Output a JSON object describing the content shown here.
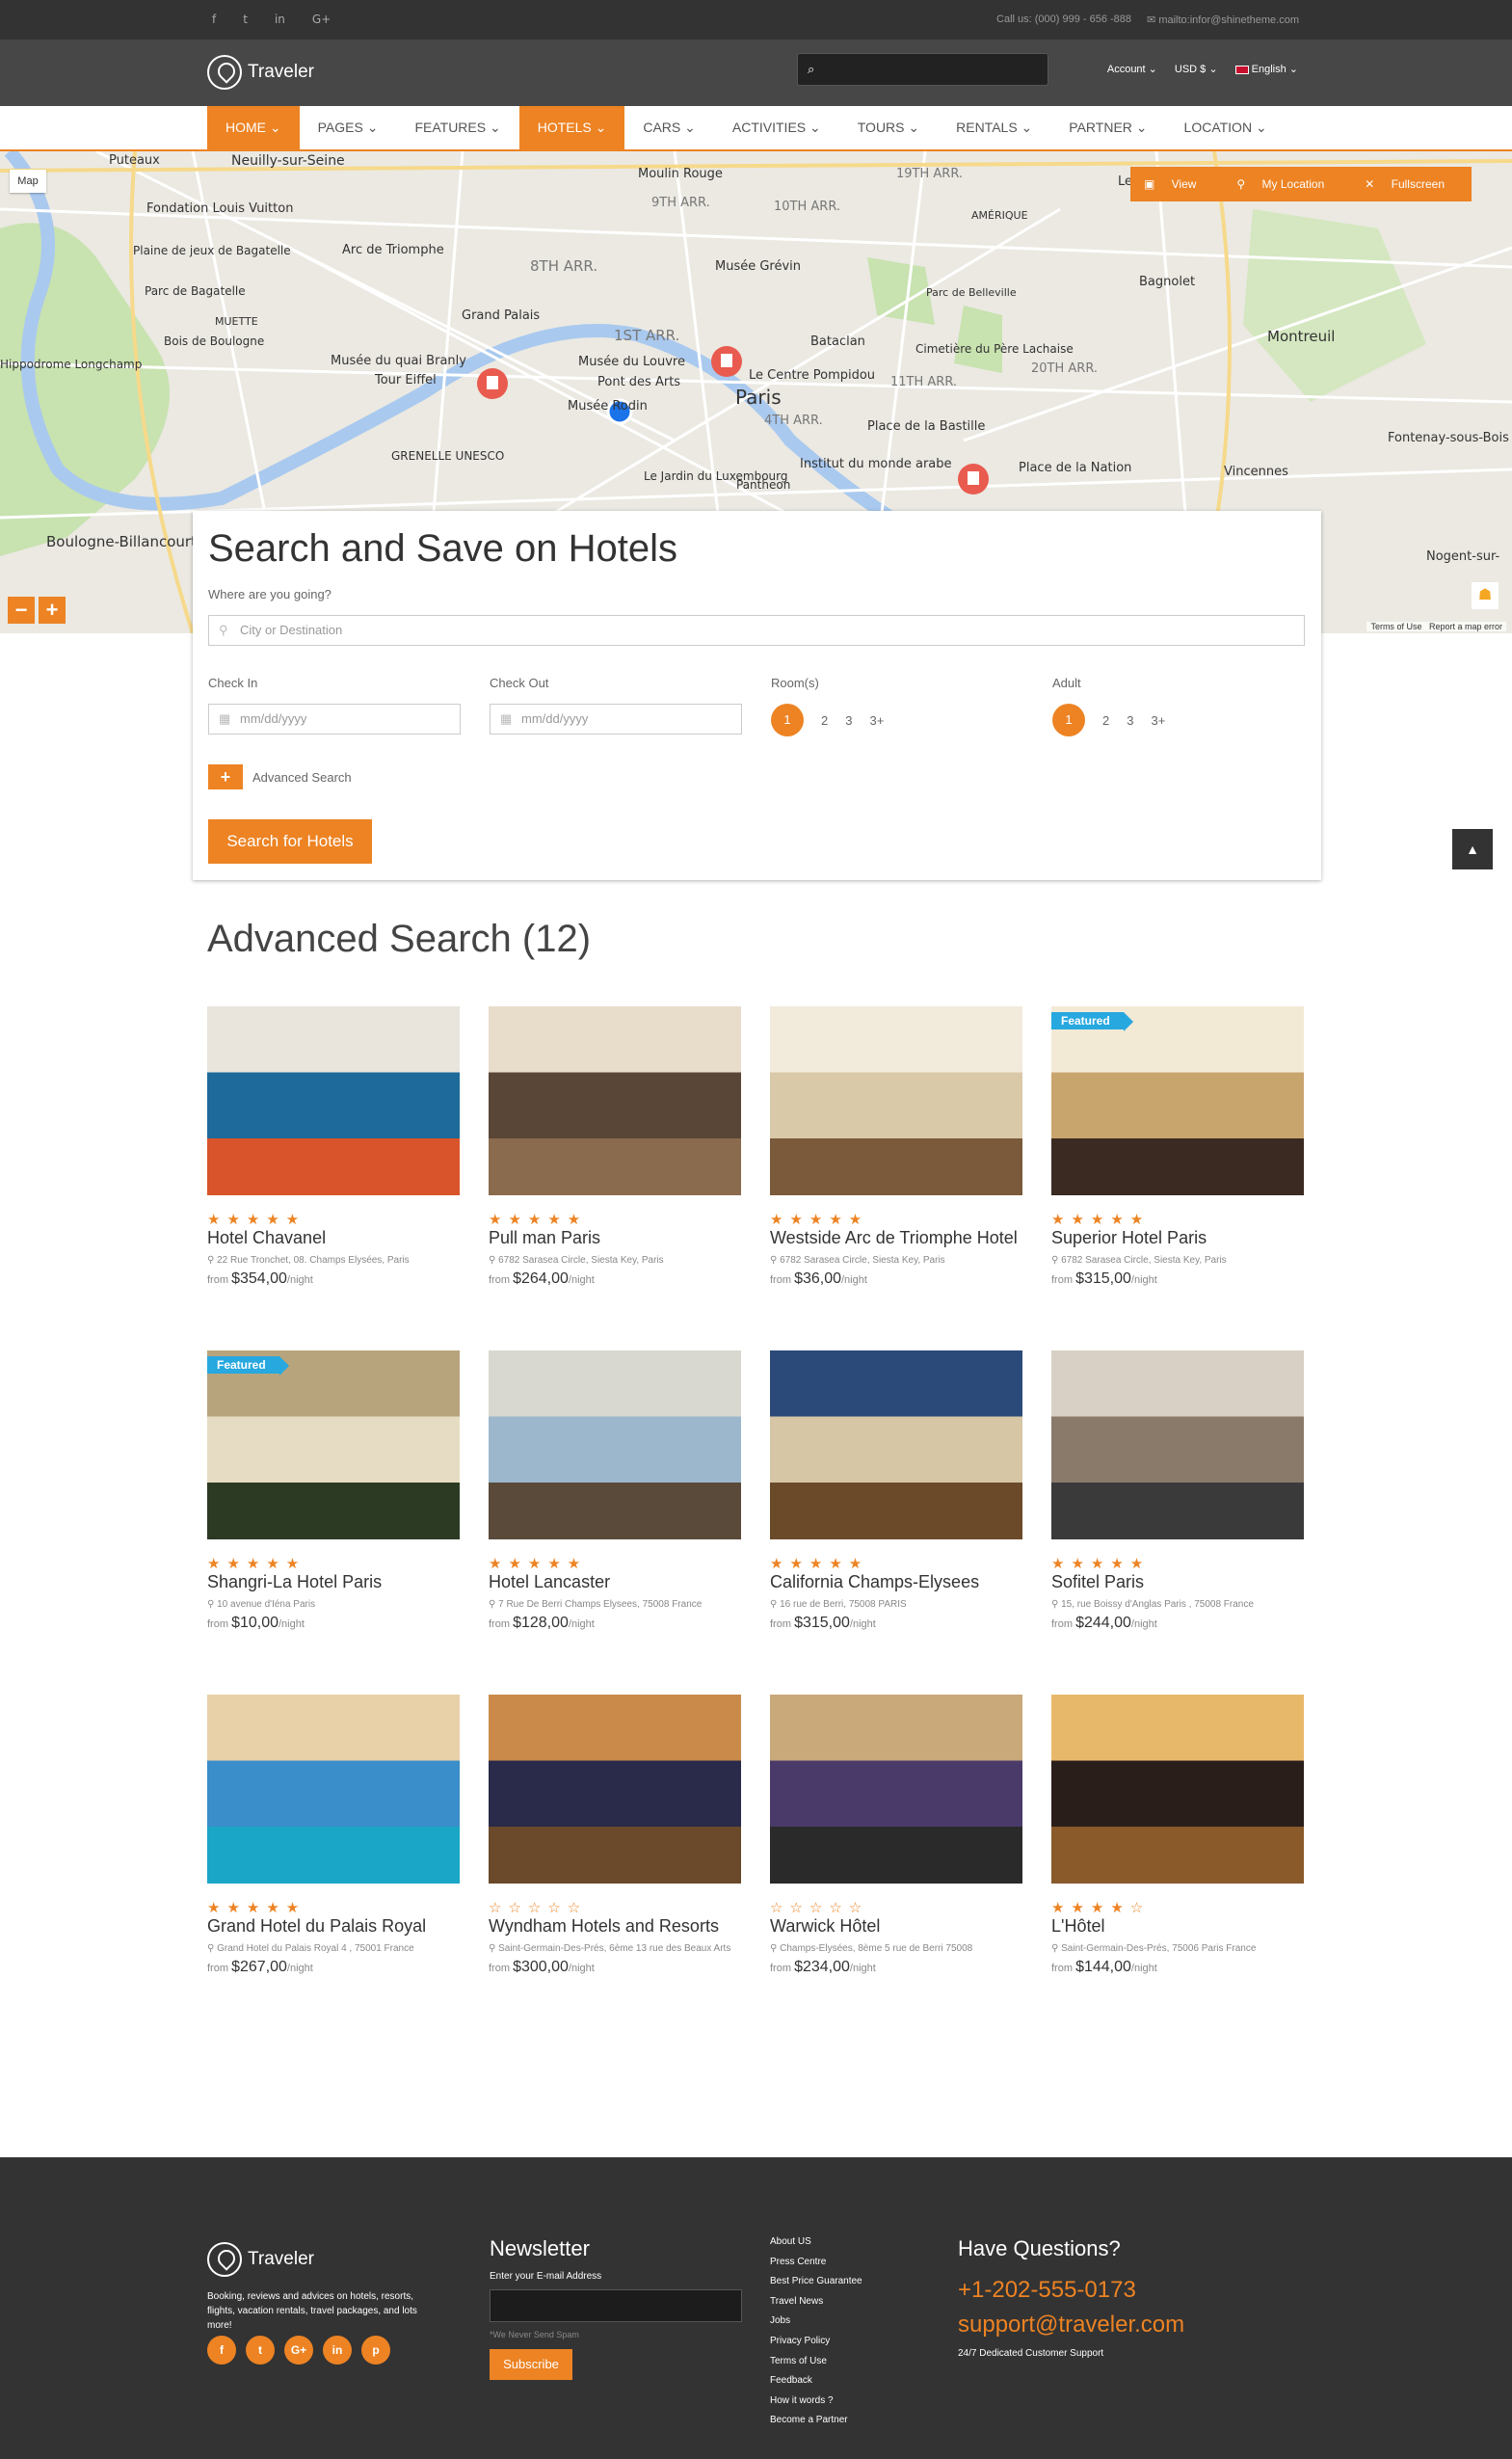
{
  "topbar": {
    "social": [
      "f",
      "t",
      "in",
      "G+"
    ],
    "phone": "Call us: (000) 999 - 656 -888",
    "email": "mailto:infor@shinetheme.com"
  },
  "header": {
    "brand": "Traveler",
    "account": "Account",
    "currency": "USD $",
    "language": "English"
  },
  "nav": [
    "HOME",
    "PAGES",
    "FEATURES",
    "HOTELS",
    "CARS",
    "ACTIVITIES",
    "TOURS",
    "RENTALS",
    "PARTNER",
    "LOCATION"
  ],
  "map": {
    "map_button": "Map",
    "tools": [
      "View",
      "My Location",
      "Fullscreen"
    ],
    "labels": [
      "Puteaux",
      "Neuilly-sur-Seine",
      "Moulin Rouge",
      "9TH ARR.",
      "10TH ARR.",
      "19TH ARR.",
      "Les Lilas",
      "Fondation Louis Vuitton",
      "Arc de Triomphe",
      "8TH ARR.",
      "Musée Grévin",
      "AMÉRIQUE",
      "Bagnolet",
      "Plaine de jeux de Bagatelle",
      "Parc de Bagatelle",
      "MUETTE",
      "Grand Palais",
      "1ST ARR.",
      "Parc de Belleville",
      "Bois de Boulogne",
      "Musée du quai Branly",
      "Musée du Louvre",
      "Pont des Arts",
      "Bataclan",
      "Cimetière du Père Lachaise",
      "Montreuil",
      "Hippodrome Longchamp",
      "Tour Eiffel",
      "Musée Rodin",
      "Le Centre Pompidou",
      "Paris",
      "11TH ARR.",
      "20TH ARR.",
      "4TH ARR.",
      "Place de la Bastille",
      "GRENELLE UNESCO",
      "Institut du monde arabe",
      "Place de la Nation",
      "Vincennes",
      "Fontenay-sous-Bois",
      "Boulogne-Billancourt",
      "Le Jardin du Luxembourg",
      "Pantheon",
      "Nogent-sur-",
      "Terms of Use",
      "Report a map error"
    ]
  },
  "search": {
    "title": "Search and Save on Hotels",
    "where_label": "Where are you going?",
    "where_placeholder": "City or Destination",
    "checkin_label": "Check In",
    "checkout_label": "Check Out",
    "date_placeholder": "mm/dd/yyyy",
    "rooms_label": "Room(s)",
    "adult_label": "Adult",
    "counter_options": [
      "1",
      "2",
      "3",
      "3+"
    ],
    "selected": "1",
    "advanced": "Advanced Search",
    "button": "Search for Hotels"
  },
  "results_title": "Advanced Search (12)",
  "hotels": [
    {
      "name": "Hotel Chavanel",
      "address": "22 Rue Tronchet, 08. Champs Elysées, Paris",
      "price": "$354,00",
      "stars": 5,
      "featured": false,
      "palette": [
        "#1e6a9a",
        "#e9e4dc",
        "#d9542a"
      ]
    },
    {
      "name": "Pull man Paris",
      "address": "6782 Sarasea Circle, Siesta Key, Paris",
      "price": "$264,00",
      "stars": 5,
      "featured": false,
      "palette": [
        "#5a4636",
        "#e8dccb",
        "#8a6b4e"
      ]
    },
    {
      "name": "Westside Arc de Triomphe Hotel",
      "address": "6782 Sarasea Circle, Siesta Key, Paris",
      "price": "$36,00",
      "stars": 5,
      "featured": false,
      "palette": [
        "#d9c9a8",
        "#f2eadb",
        "#7a5a3a"
      ]
    },
    {
      "name": "Superior Hotel Paris",
      "address": "6782 Sarasea Circle, Siesta Key, Paris",
      "price": "$315,00",
      "stars": 5,
      "featured": true,
      "palette": [
        "#c9a56e",
        "#f3ead6",
        "#3a2a22"
      ]
    },
    {
      "name": "Shangri-La Hotel Paris",
      "address": "10 avenue d'Iéna Paris",
      "price": "$10,00",
      "stars": 5,
      "featured": true,
      "palette": [
        "#e6dcc4",
        "#b8a47c",
        "#2c3a24"
      ]
    },
    {
      "name": "Hotel Lancaster",
      "address": "7 Rue De Berri Champs Elysees, 75008 France",
      "price": "$128,00",
      "stars": 5,
      "featured": false,
      "palette": [
        "#9cb7cc",
        "#d8d8d0",
        "#5a4a3a"
      ]
    },
    {
      "name": "California Champs-Elysees",
      "address": "16 rue de Berri, 75008 PARIS",
      "price": "$315,00",
      "stars": 5,
      "featured": false,
      "palette": [
        "#d6c6a6",
        "#2b4a7a",
        "#6b4a2a"
      ]
    },
    {
      "name": "Sofitel Paris",
      "address": "15, rue Boissy d'Anglas Paris , 75008 France",
      "price": "$244,00",
      "stars": 5,
      "featured": false,
      "palette": [
        "#8a7a6a",
        "#d8d0c4",
        "#3a3a3a"
      ]
    },
    {
      "name": "Grand Hotel du Palais Royal",
      "address": "Grand Hotel du Palais Royal 4 , 75001 France",
      "price": "$267,00",
      "stars": 5,
      "featured": false,
      "palette": [
        "#3a8ec9",
        "#e8d0a8",
        "#1aa6c6"
      ]
    },
    {
      "name": "Wyndham Hotels and Resorts",
      "address": "Saint-Germain-Des-Prés, 6ème 13 rue des Beaux Arts",
      "price": "$300,00",
      "stars": 0,
      "featured": false,
      "palette": [
        "#2a2a4a",
        "#c98a4a",
        "#6a4a2a"
      ]
    },
    {
      "name": "Warwick Hôtel",
      "address": "Champs-Elysées, 8ème 5 rue de Berri 75008",
      "price": "$234,00",
      "stars": 0,
      "featured": false,
      "palette": [
        "#4a3a6a",
        "#c9a87a",
        "#2a2a2a"
      ]
    },
    {
      "name": "L'Hôtel",
      "address": "Saint-Germain-Des-Prés, 75006 Paris France",
      "price": "$144,00",
      "stars": 4,
      "featured": false,
      "palette": [
        "#2a1e1a",
        "#e8b86a",
        "#8a5a2a"
      ]
    }
  ],
  "labels": {
    "featured": "Featured",
    "from": "from",
    "night": "/night"
  },
  "footer": {
    "brand": "Traveler",
    "about": "Booking, reviews and advices on hotels, resorts, flights, vacation rentals, travel packages, and lots more!",
    "social": [
      "f",
      "t",
      "G+",
      "in",
      "p"
    ],
    "newsletter_title": "Newsletter",
    "newsletter_label": "Enter your E-mail Address",
    "spam_note": "*We Never Send Spam",
    "subscribe": "Subscribe",
    "links": [
      "About US",
      "Press Centre",
      "Best Price Guarantee",
      "Travel News",
      "Jobs",
      "Privacy Policy",
      "Terms of Use",
      "Feedback",
      "How it words ?",
      "Become a Partner"
    ],
    "questions_title": "Have Questions?",
    "phone": "+1-202-555-0173",
    "email": "support@traveler.com",
    "support": "24/7 Dedicated Customer Support"
  },
  "colors": {
    "accent": "#ed8323",
    "dark": "#333333",
    "header": "#474747",
    "featured": "#27a8df"
  }
}
